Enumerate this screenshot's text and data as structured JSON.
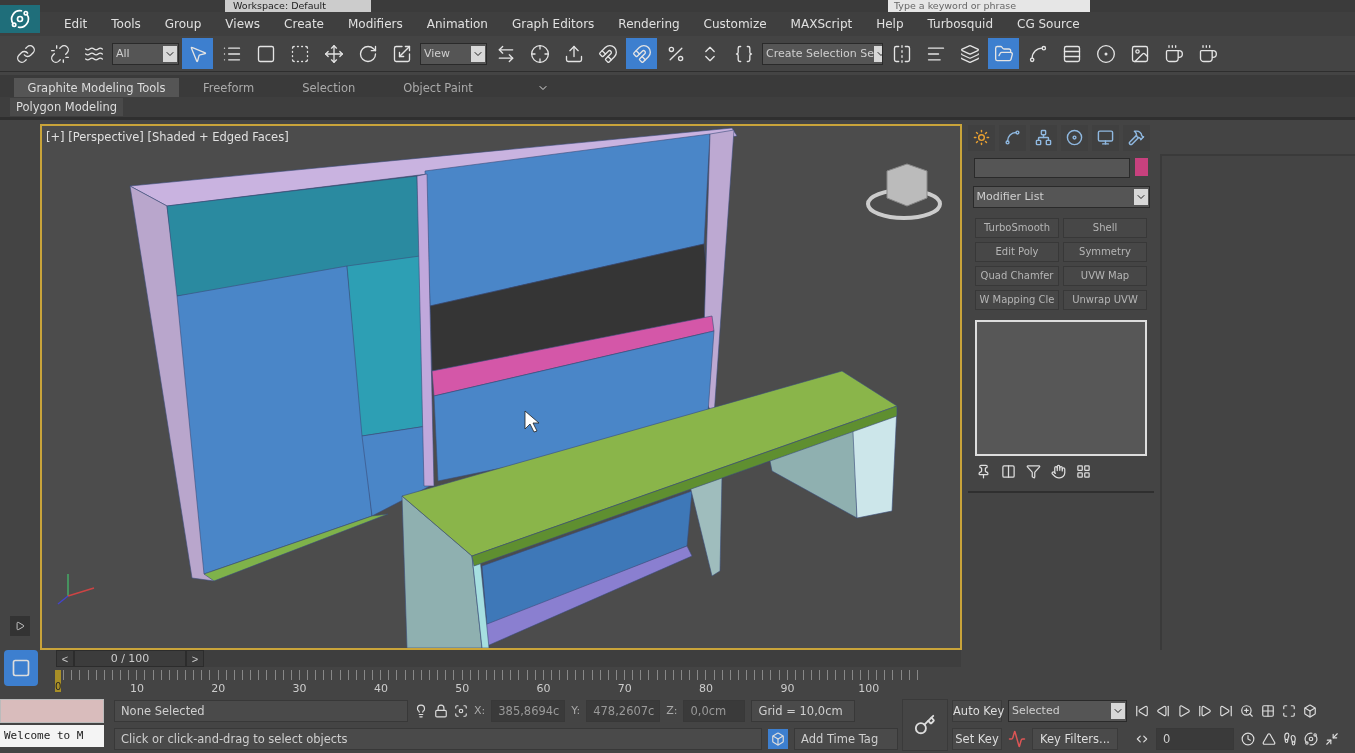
{
  "title_bar": {
    "workspace": "Workspace: Default",
    "search_placeholder": "Type a keyword or phrase"
  },
  "menu": [
    "Edit",
    "Tools",
    "Group",
    "Views",
    "Create",
    "Modifiers",
    "Animation",
    "Graph Editors",
    "Rendering",
    "Customize",
    "MAXScript",
    "Help",
    "Turbosquid",
    "CG Source"
  ],
  "toolbar": [
    {
      "kind": "button",
      "selected": false
    },
    {
      "kind": "button",
      "selected": false
    },
    {
      "kind": "button",
      "selected": false
    },
    {
      "kind": "dropdown",
      "value": "All"
    },
    {
      "kind": "button",
      "selected": true
    },
    {
      "kind": "button",
      "selected": false
    },
    {
      "kind": "button",
      "selected": false
    },
    {
      "kind": "button",
      "selected": false
    },
    {
      "kind": "button",
      "selected": false
    },
    {
      "kind": "button",
      "selected": false
    },
    {
      "kind": "button",
      "selected": false
    },
    {
      "kind": "dropdown",
      "value": "View"
    },
    {
      "kind": "button",
      "selected": false
    },
    {
      "kind": "button",
      "selected": false
    },
    {
      "kind": "button",
      "selected": false
    },
    {
      "kind": "button",
      "selected": false
    },
    {
      "kind": "button",
      "selected": true
    },
    {
      "kind": "button",
      "selected": false
    },
    {
      "kind": "button",
      "selected": false
    },
    {
      "kind": "button",
      "selected": false
    },
    {
      "kind": "dropdown",
      "value": "Create Selection Se"
    },
    {
      "kind": "button",
      "selected": false
    },
    {
      "kind": "button",
      "selected": false
    },
    {
      "kind": "button",
      "selected": false
    },
    {
      "kind": "button",
      "selected": true
    },
    {
      "kind": "button",
      "selected": false
    },
    {
      "kind": "button",
      "selected": false
    },
    {
      "kind": "button",
      "selected": false
    },
    {
      "kind": "button",
      "selected": false
    },
    {
      "kind": "button",
      "selected": false
    },
    {
      "kind": "button",
      "selected": false
    }
  ],
  "ribbon": {
    "tabs": [
      {
        "label": "Graphite Modeling Tools",
        "selected": true
      },
      {
        "label": "Freeform",
        "selected": false
      },
      {
        "label": "Selection",
        "selected": false
      },
      {
        "label": "Object Paint",
        "selected": false
      }
    ],
    "panel_label": "Polygon Modeling"
  },
  "viewport": {
    "label": "[+] [Perspective] [Shaded + Edged Faces]",
    "active": true
  },
  "command_panel": {
    "modifier_dropdown": "Modifier List",
    "modifier_buttons": [
      "TurboSmooth",
      "Shell",
      "Edit Poly",
      "Symmetry",
      "Quad Chamfer",
      "UVW Map",
      "W Mapping Cle",
      "Unwrap UVW"
    ]
  },
  "time_slider": {
    "prev": "<",
    "label": "0 / 100",
    "next": ">",
    "level": 0
  },
  "trackbar": {
    "current": "0",
    "ticks": [
      "10",
      "20",
      "30",
      "40",
      "50",
      "60",
      "70",
      "80",
      "90",
      "100"
    ]
  },
  "status": {
    "listener": "Welcome to M",
    "selection": "None Selected",
    "prompt": "Click or click-and-drag to select objects",
    "x_label": "X:",
    "x": "385,8694c",
    "y_label": "Y:",
    "y": "478,2607c",
    "z_label": "Z:",
    "z": "0,0cm",
    "grid": "Grid = 10,0cm",
    "time_tag": "Add Time Tag",
    "auto_key": "Auto Key",
    "set_key": "Set Key",
    "key_mode": "Selected",
    "key_filters": "Key Filters...",
    "frame": "0"
  }
}
